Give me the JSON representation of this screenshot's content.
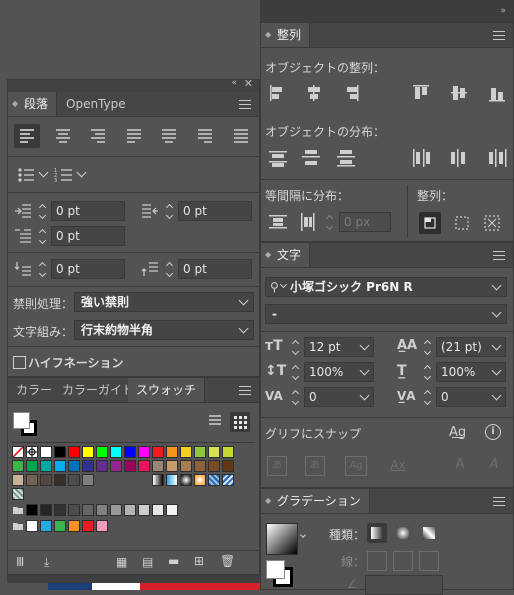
{
  "paragraph_panel": {
    "tabs": [
      "段落",
      "OpenType"
    ],
    "indent_left": "0 pt",
    "indent_right": "0 pt",
    "first_line_indent": "0 pt",
    "space_before": "0 pt",
    "space_after": "0 pt",
    "kinsoku_label": "禁則処理：",
    "kinsoku_value": "強い禁則",
    "mojikumi_label": "文字組み：",
    "mojikumi_value": "行末約物半角",
    "hyphenation_label": "ハイフネーション"
  },
  "swatches_panel": {
    "tabs": [
      "カラー",
      "カラーガイド",
      "スウォッチ"
    ],
    "colors": [
      "#ffffff",
      "#000000",
      "#ff0000",
      "#ffff00",
      "#00ff00",
      "#00ffff",
      "#0000ff",
      "#ff00ff",
      "#ee1c24",
      "#f7941d",
      "#f7d117",
      "#8dc63f",
      "#d4e157",
      "#c5d92e",
      "#39b54a",
      "#00a651",
      "#00a99d",
      "#00aeef",
      "#0072bc",
      "#2e3192",
      "#662d91",
      "#92278f",
      "#9e005d",
      "#ed145b",
      "#998675",
      "#c69c6d",
      "#a67c52",
      "#8c6239",
      "#754c24",
      "#603813",
      "#c7b299",
      "#736357",
      "#534741",
      "#362f2d",
      "#4d4d4d",
      "#808080"
    ],
    "grays": [
      "#000000",
      "#262626",
      "#333333",
      "#4d4d4d",
      "#666666",
      "#808080",
      "#999999",
      "#b3b3b3",
      "#cccccc",
      "#e6e6e6",
      "#f2f2f2"
    ],
    "group_colors": [
      "#ffffff",
      "#29abe2",
      "#39b54a",
      "#f7931e",
      "#ed1c24",
      "#f49ac1"
    ]
  },
  "align_panel": {
    "tab": "整列",
    "align_objects_label": "オブジェクトの整列：",
    "distribute_objects_label": "オブジェクトの分布：",
    "distribute_spacing_label": "等間隔に分布：",
    "spacing_value": "0 px",
    "align_to_label": "整列："
  },
  "character_panel": {
    "tab": "文字",
    "font_family": "小塚ゴシック Pr6N R",
    "font_style": "-",
    "font_size": "12 pt",
    "leading": "(21 pt)",
    "vertical_scale": "100%",
    "horizontal_scale": "100%",
    "kerning": "0",
    "tracking": "0",
    "snap_label": "グリフにスナップ"
  },
  "gradient_panel": {
    "tab": "グラデーション",
    "type_label": "種類：",
    "stroke_label": "線："
  }
}
